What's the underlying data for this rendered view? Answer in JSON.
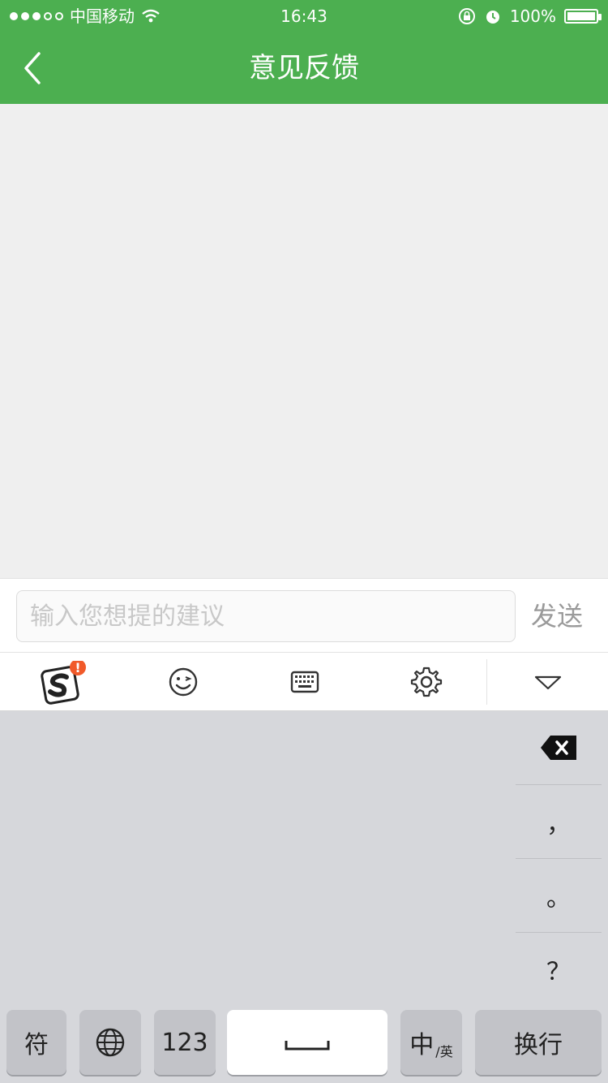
{
  "status_bar": {
    "carrier": "中国移动",
    "time": "16:43",
    "battery_percent": "100%",
    "signal_bars_filled": 3,
    "signal_bars_total": 5
  },
  "nav": {
    "title": "意见反馈",
    "back_icon": "chevron-left-icon"
  },
  "feedback": {
    "placeholder": "输入您想提的建议",
    "send_label": "发送"
  },
  "keyboard_toolbar": {
    "items": [
      "sogou-logo-icon",
      "emoji-icon",
      "keyboard-icon",
      "gear-icon",
      "collapse-triangle-icon"
    ],
    "badge": "!"
  },
  "keyboard": {
    "side_keys": [
      "，",
      "。",
      "？"
    ],
    "delete_icon": "backspace-icon",
    "bottom_row": {
      "symbols": "符",
      "globe_icon": "globe-icon",
      "numbers": "123",
      "space_icon": "space-icon",
      "lang_main": "中",
      "lang_sub": "/英",
      "enter": "换行"
    }
  },
  "colors": {
    "header_green": "#4caf50",
    "badge_red": "#f15a2a",
    "keyboard_bg": "#d6d7db"
  }
}
